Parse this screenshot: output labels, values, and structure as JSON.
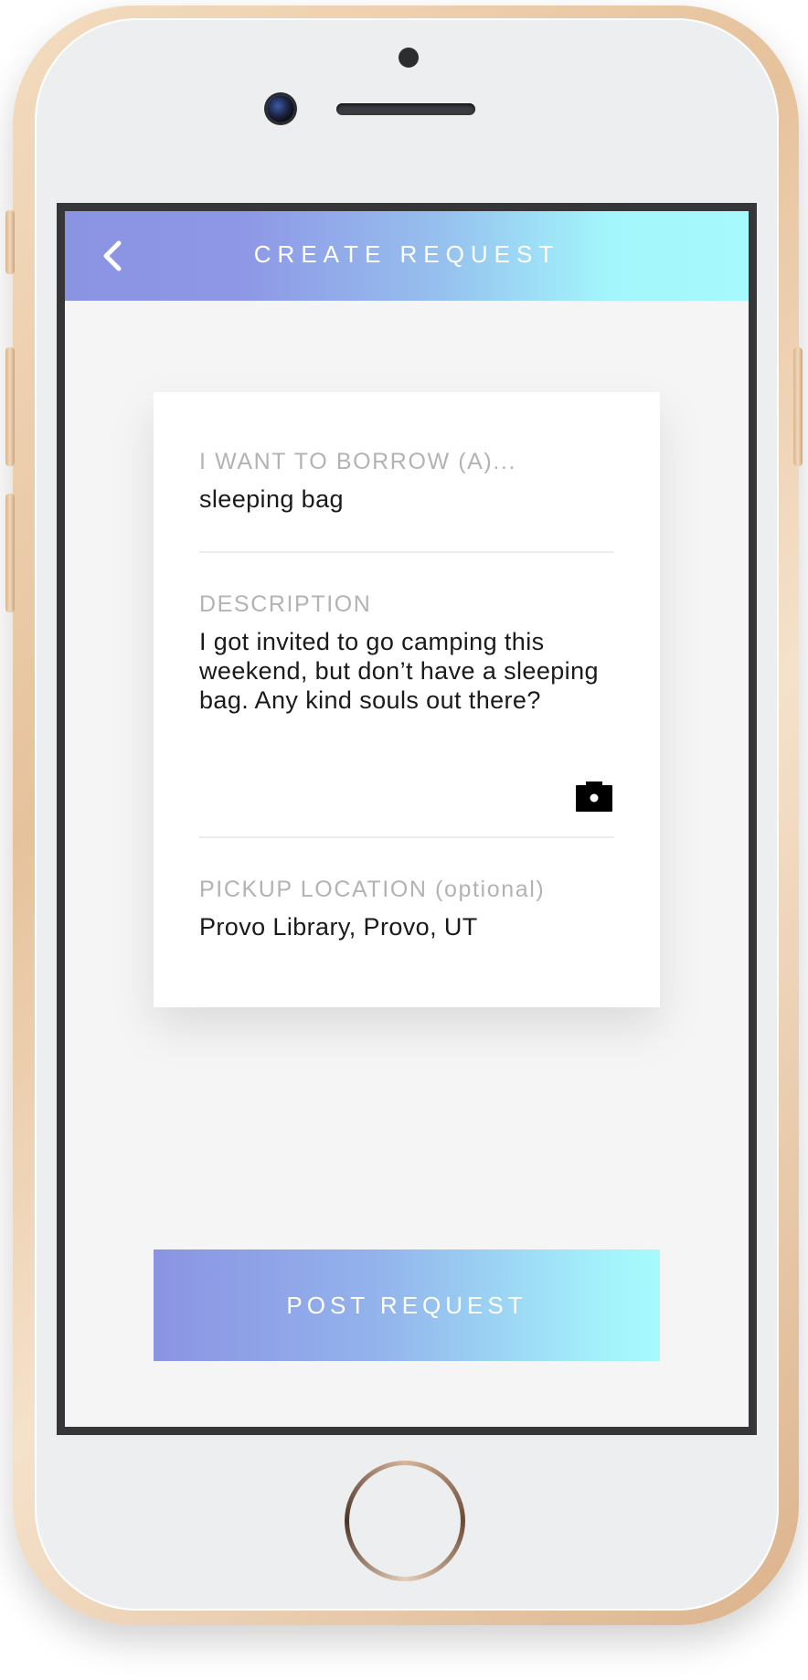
{
  "header": {
    "title": "CREATE REQUEST",
    "back_icon": "chevron-left-icon"
  },
  "form": {
    "borrow": {
      "label": "I WANT TO BORROW (A)...",
      "value": "sleeping bag"
    },
    "description": {
      "label": "DESCRIPTION",
      "value": "I got invited to go camping this weekend, but don’t have a sleeping bag. Any kind souls out there?",
      "attach_icon": "camera-icon"
    },
    "location": {
      "label": "PICKUP LOCATION (optional)",
      "value": "Provo Library, Provo, UT"
    }
  },
  "submit": {
    "label": "POST REQUEST"
  },
  "colors": {
    "gradient_start": "#8b93e3",
    "gradient_end": "#a6fafd",
    "label_gray": "#b3b3b3",
    "text_dark": "#1a1a1a",
    "background": "#f5f5f5"
  }
}
